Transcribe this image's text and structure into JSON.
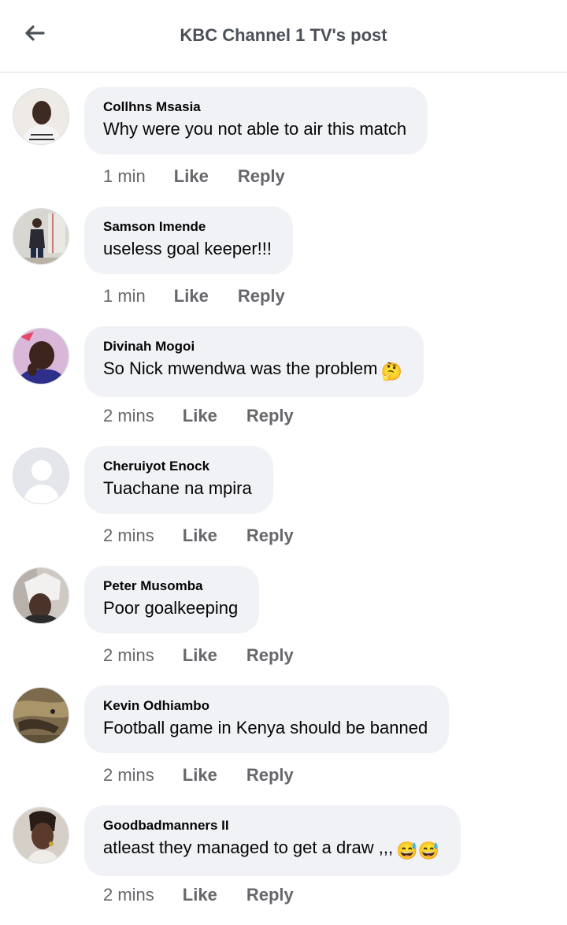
{
  "header": {
    "title": "KBC Channel 1 TV's post"
  },
  "comments": [
    {
      "author": "Collhns Msasia",
      "text": "Why were you not able to air this match",
      "time": "1 min",
      "like": "Like",
      "reply": "Reply",
      "avatar_color": "#c9c2bc"
    },
    {
      "author": "Samson Imende",
      "text": "useless goal keeper!!!",
      "time": "1 min",
      "like": "Like",
      "reply": "Reply",
      "avatar_color": "#b7b9b4"
    },
    {
      "author": "Divinah Mogoi",
      "text": "So Nick mwendwa was the problem",
      "emoji": "🤔",
      "time": "2 mins",
      "like": "Like",
      "reply": "Reply",
      "avatar_color": "#c4a6c9"
    },
    {
      "author": "Cheruiyot Enock",
      "text": "Tuachane na mpira",
      "time": "2 mins",
      "like": "Like",
      "reply": "Reply",
      "avatar_color": "#e4e6eb"
    },
    {
      "author": "Peter Musomba",
      "text": "Poor goalkeeping",
      "time": "2 mins",
      "like": "Like",
      "reply": "Reply",
      "avatar_color": "#9e8f85"
    },
    {
      "author": "Kevin Odhiambo",
      "text": "Football game in Kenya should be banned",
      "time": "2 mins",
      "like": "Like",
      "reply": "Reply",
      "avatar_color": "#8c7a5c"
    },
    {
      "author": "Goodbadmanners II",
      "text": " atleast they managed to get a draw  ,,,",
      "emoji": "😅😅",
      "time": "2 mins",
      "like": "Like",
      "reply": "Reply",
      "avatar_color": "#b99a85"
    }
  ]
}
